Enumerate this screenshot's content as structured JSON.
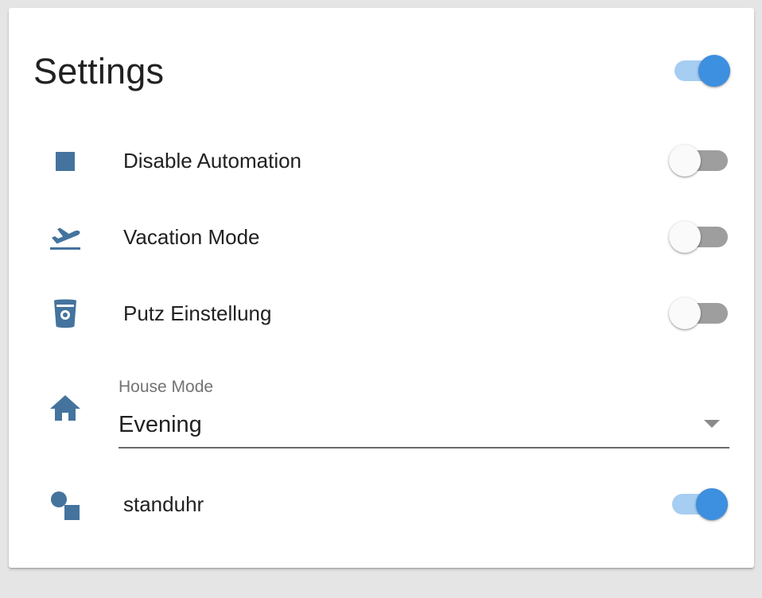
{
  "card": {
    "title": "Settings",
    "header_toggle_on": true
  },
  "rows": [
    {
      "label": "Disable Automation",
      "icon": "stop-icon",
      "toggle_on": false
    },
    {
      "label": "Vacation Mode",
      "icon": "airplane-takeoff-icon",
      "toggle_on": false
    },
    {
      "label": "Putz Einstellung",
      "icon": "trash-bucket-icon",
      "toggle_on": false
    },
    {
      "label": "standuhr",
      "icon": "shapes-icon",
      "toggle_on": true
    }
  ],
  "house_mode": {
    "label": "House Mode",
    "value": "Evening",
    "icon": "home-icon"
  },
  "colors": {
    "icon": "#44739e",
    "toggle_on_thumb": "#3d8fe0",
    "toggle_on_track": "#a6cdf2",
    "toggle_off_track": "#9e9e9e"
  }
}
